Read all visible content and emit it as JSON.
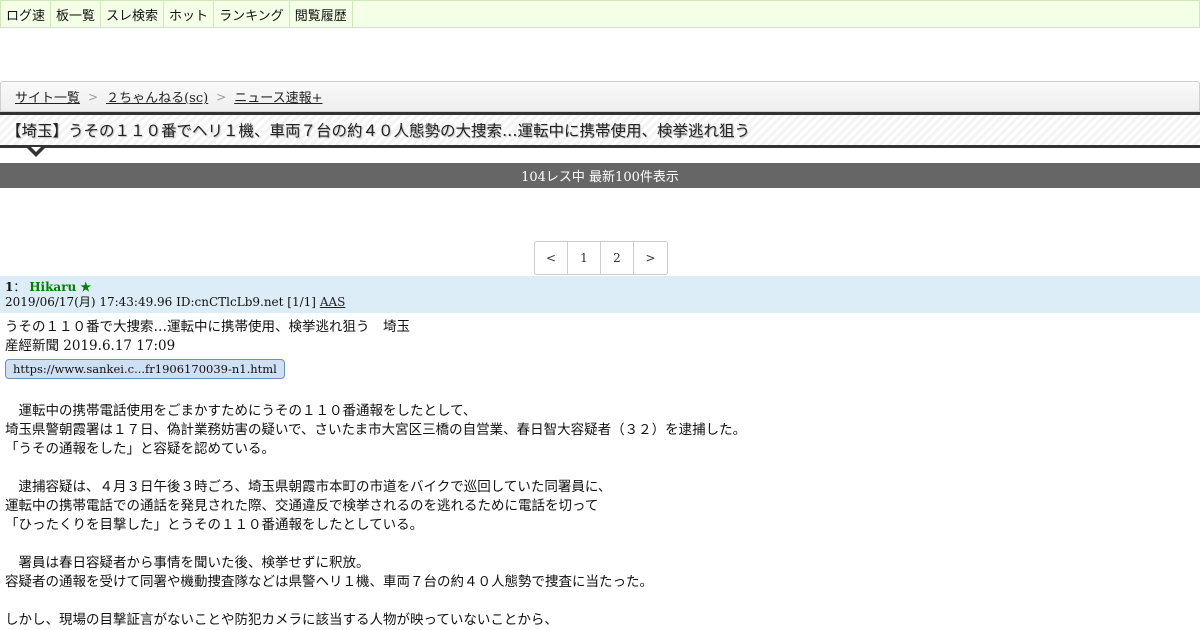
{
  "topnav": {
    "items": [
      "ログ速",
      "板一覧",
      "スレ検索",
      "ホット",
      "ランキング",
      "閲覧履歴"
    ]
  },
  "breadcrumb": {
    "items": [
      "サイト一覧",
      "２ちゃんねる(sc)",
      "ニュース速報+"
    ],
    "separator": ">"
  },
  "thread": {
    "title": "【埼玉】うその１１０番でヘリ１機、車両７台の約４０人態勢の大捜索…運転中に携帯使用、検挙逃れ狙う"
  },
  "count_bar": {
    "text": "104レス中 最新100件表示"
  },
  "pager": {
    "prev": "<",
    "pages": [
      "1",
      "2"
    ],
    "next": ">"
  },
  "post": {
    "number": "1",
    "separator": "：",
    "name": "Hikaru ★",
    "meta": "2019/06/17(月) 17:43:49.96 ID:cnCTlcLb9.net [1/1]",
    "aas": "AAS",
    "lines_before_link": [
      "うその１１０番で大捜索…運転中に携帯使用、検挙逃れ狙う　埼玉",
      "産經新聞 2019.6.17 17:09"
    ],
    "link": "https://www.sankei.c...fr1906170039-n1.html",
    "paragraphs": [
      [
        "　運転中の携帯電話使用をごまかすためにうその１１０番通報をしたとして、",
        "埼玉県警朝霞署は１７日、偽計業務妨害の疑いで、さいたま市大宮区三橋の自営業、春日智大容疑者（３２）を逮捕した。",
        "「うその通報をした」と容疑を認めている。"
      ],
      [
        "　逮捕容疑は、４月３日午後３時ごろ、埼玉県朝霞市本町の市道をバイクで巡回していた同署員に、",
        "運転中の携帯電話での通話を発見された際、交通違反で検挙されるのを逃れるために電話を切って",
        "「ひったくりを目撃した」とうその１１０番通報をしたとしている。"
      ],
      [
        "　署員は春日容疑者から事情を聞いた後、検挙せずに釈放。",
        "容疑者の通報を受けて同署や機動捜査隊などは県警ヘリ１機、車両７台の約４０人態勢で捜査に当たった。"
      ],
      [
        "しかし、現場の目撃証言がないことや防犯カメラに該当する人物が映っていないことから、"
      ]
    ]
  }
}
